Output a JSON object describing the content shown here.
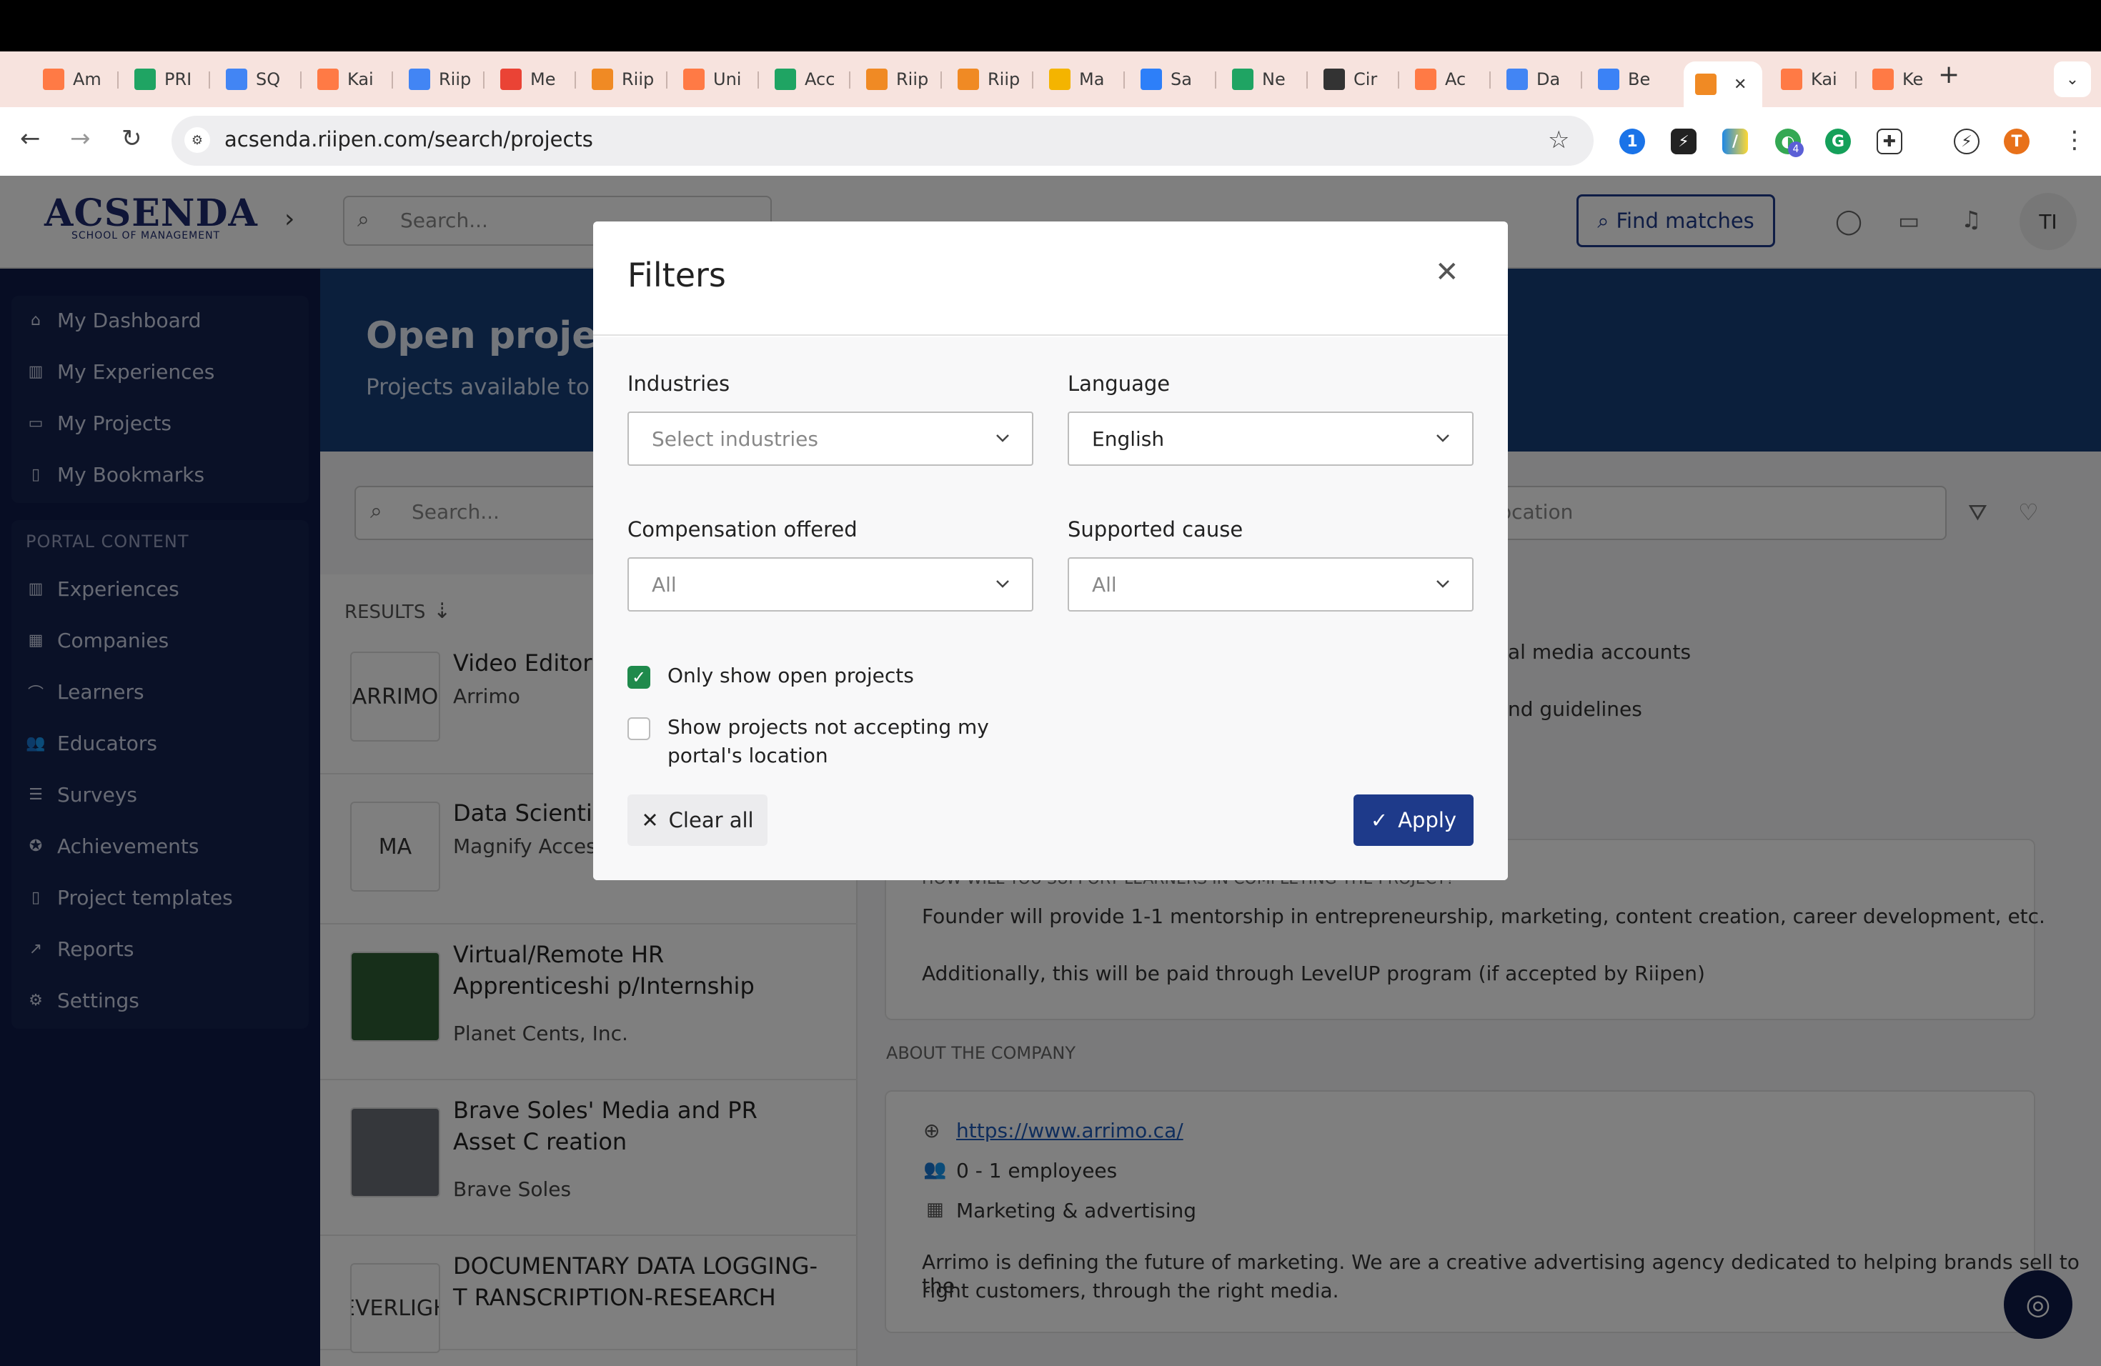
{
  "browser": {
    "tabs": [
      {
        "label": "Am",
        "icon": "hubspot-icon",
        "color": "#ff7a45"
      },
      {
        "label": "PRI",
        "icon": "sheets-icon",
        "color": "#1fa463"
      },
      {
        "label": "SQ",
        "icon": "docs-icon",
        "color": "#4285f4"
      },
      {
        "label": "Kai",
        "icon": "hubspot-icon",
        "color": "#ff7a45"
      },
      {
        "label": "Riip",
        "icon": "calendar-icon",
        "color": "#4285f4"
      },
      {
        "label": "Me",
        "icon": "gmail-icon",
        "color": "#ea4335"
      },
      {
        "label": "Riip",
        "icon": "riipen-icon",
        "color": "#f08a24"
      },
      {
        "label": "Uni",
        "icon": "hubspot-icon",
        "color": "#ff7a45"
      },
      {
        "label": "Acc",
        "icon": "sheets-icon",
        "color": "#1fa463"
      },
      {
        "label": "Riip",
        "icon": "riipen-icon",
        "color": "#f08a24"
      },
      {
        "label": "Riip",
        "icon": "riipen-icon",
        "color": "#f08a24"
      },
      {
        "label": "Ma",
        "icon": "slides-icon",
        "color": "#f4b400"
      },
      {
        "label": "Sa",
        "icon": "airtable-icon",
        "color": "#2d7ff9"
      },
      {
        "label": "Ne",
        "icon": "sheets-icon",
        "color": "#1fa463"
      },
      {
        "label": "Cir",
        "icon": "circle-icon",
        "color": "#333333"
      },
      {
        "label": "Ac",
        "icon": "hubspot-icon",
        "color": "#ff7a45"
      },
      {
        "label": "Da",
        "icon": "calendar-icon",
        "color": "#4285f4"
      },
      {
        "label": "Be",
        "icon": "beta-icon",
        "color": "#3b82f6"
      },
      {
        "label": "",
        "icon": "riipen-icon",
        "color": "#f08a24",
        "active": true
      },
      {
        "label": "Kai",
        "icon": "hubspot-icon",
        "color": "#ff7a45"
      },
      {
        "label": "Ke",
        "icon": "hubspot-icon",
        "color": "#ff7a45"
      }
    ],
    "url": "acsenda.riipen.com/search/projects",
    "profile_initial": "T",
    "ext_badge": "4"
  },
  "app": {
    "logo": "ACSENDA",
    "logo_sub": "SCHOOL OF MANAGEMENT",
    "header_search_placeholder": "Search...",
    "find_matches": "Find matches",
    "avatar": "TI",
    "sidebar_top": [
      "My Dashboard",
      "My Experiences",
      "My Projects",
      "My Bookmarks"
    ],
    "sidebar_heading": "PORTAL CONTENT",
    "sidebar_portal": [
      "Experiences",
      "Companies",
      "Learners",
      "Educators",
      "Surveys",
      "Achievements",
      "Project templates",
      "Reports",
      "Settings"
    ],
    "hero_title": "Open projects",
    "hero_sub": "Projects available to a",
    "search_placeholder": "Search...",
    "location_placeholder": "ocation",
    "results_label": "RESULTS",
    "cards": [
      {
        "title": "Video Editor",
        "company": "Arrimo",
        "thumb": "ARRIMO"
      },
      {
        "title": "Data Scientis",
        "company": "Magnify Access",
        "thumb": "MA"
      },
      {
        "title": "Virtual/Remote HR Apprenticeshi p/Internship",
        "company": "Planet Cents, Inc.",
        "thumb": ""
      },
      {
        "title": "Brave Soles' Media and PR Asset C reation",
        "company": "Brave Soles",
        "thumb": ""
      },
      {
        "title": "DOCUMENTARY DATA LOGGING-T RANSCRIPTION-RESEARCH",
        "company": "",
        "thumb": "SEVERLIGHT"
      }
    ],
    "detail_lines": {
      "l1": "al media accounts",
      "l2": "nd guidelines",
      "support_heading": "HOW WILL YOU SUPPORT LEARNERS IN COMPLETING THE PROJECT?",
      "support1": "Founder will provide 1-1 mentorship in entrepreneurship, marketing, content creation, career development, etc.",
      "support2": "Additionally, this will be paid through LevelUP program (if accepted by Riipen)",
      "about_heading": "ABOUT THE COMPANY",
      "website": "https://www.arrimo.ca/",
      "employees": "0 - 1 employees",
      "industry": "Marketing & advertising",
      "desc1": "Arrimo is defining the future of marketing. We are a creative advertising agency dedicated to helping brands sell to the",
      "desc2": "right customers, through the right media."
    }
  },
  "modal": {
    "title": "Filters",
    "industries_label": "Industries",
    "industries_placeholder": "Select industries",
    "language_label": "Language",
    "language_value": "English",
    "compensation_label": "Compensation offered",
    "compensation_value": "All",
    "cause_label": "Supported cause",
    "cause_value": "All",
    "only_open_label": "Only show open projects",
    "only_open_checked": true,
    "not_accepting_label_1": "Show projects not accepting my",
    "not_accepting_label_2": "portal's location",
    "not_accepting_checked": false,
    "clear_all": "Clear all",
    "apply": "Apply"
  },
  "colors": {
    "brand_navy": "#1e3a8a",
    "sidebar": "#0e1a48",
    "checkbox_green": "#1f8a4c",
    "tabstrip": "#f7e3de"
  }
}
